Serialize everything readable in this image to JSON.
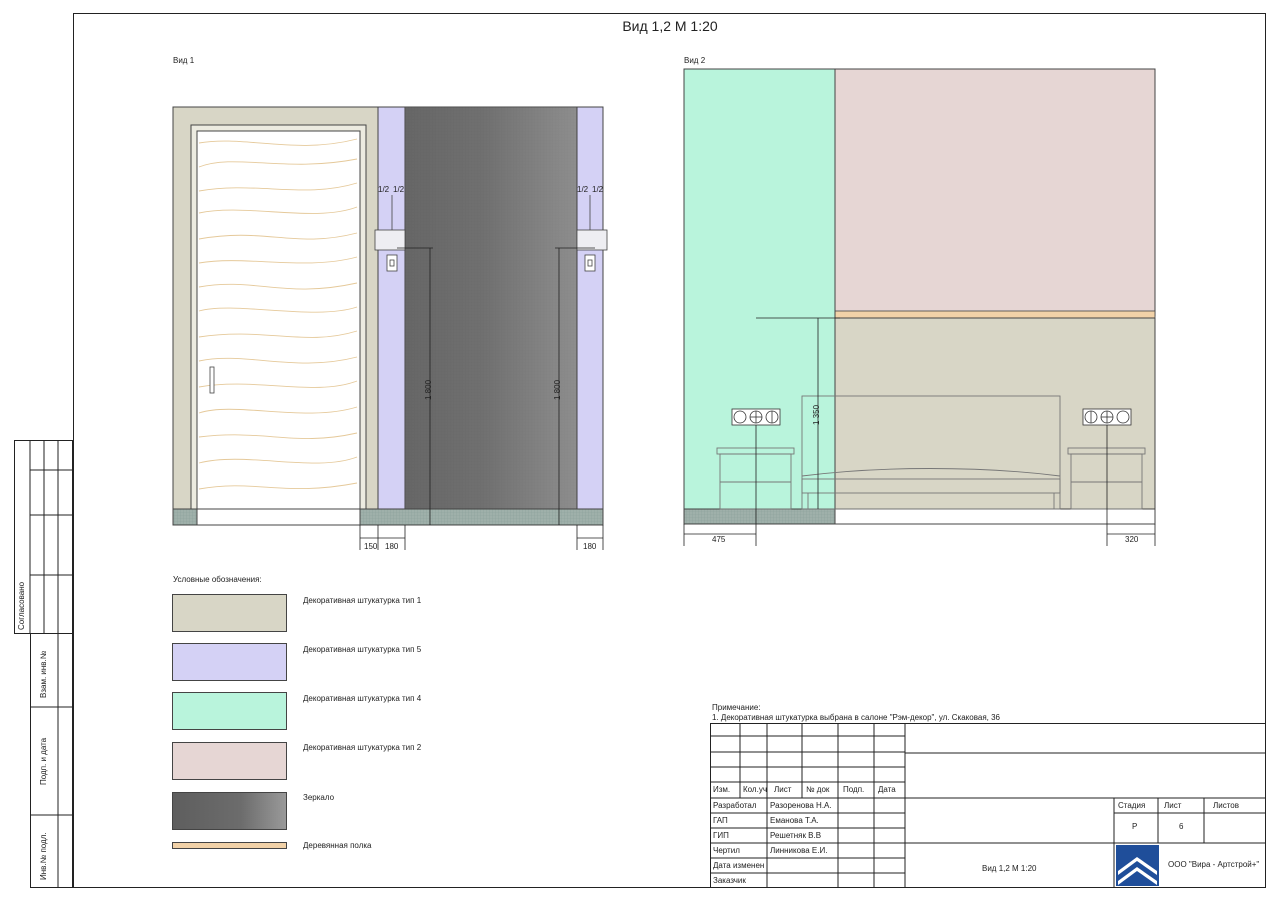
{
  "title": "Вид 1,2  М 1:20",
  "view1": {
    "label": "Вид 1",
    "dims": {
      "left_gap": "150",
      "left_panel": "180",
      "right_panel": "180",
      "height_left": "1 800",
      "height_right": "1 800"
    },
    "switch_labels": [
      "1/2",
      "1/2",
      "1/2",
      "1/2"
    ]
  },
  "view2": {
    "label": "Вид 2",
    "dims": {
      "left": "475",
      "right": "320",
      "height": "1 350"
    }
  },
  "legend": {
    "title": "Условные обозначения:",
    "items": [
      {
        "label": "Декоративная штукатурка тип 1",
        "color": "#d8d6c6"
      },
      {
        "label": "Декоративная штукатурка тип 5",
        "color": "#d4d1f5"
      },
      {
        "label": "Декоративная штукатурка тип 4",
        "color": "#b9f4dc"
      },
      {
        "label": "Декоративная штукатурка тип 2",
        "color": "#e6d6d4"
      },
      {
        "label": "Зеркало",
        "color": "#6e6e6e"
      },
      {
        "label": "Деревянная полка",
        "color": "#f2d2a8"
      }
    ]
  },
  "note": {
    "heading": "Примечание:",
    "text": "1. Декоративная штукатурка выбрана в салоне \"Рэм-декор\", ул. Скаковая, 36"
  },
  "left_margin": {
    "agreed": "Согласовано",
    "fields": [
      "Взам. инв.№",
      "Подп. и дата",
      "Инв.№ подл."
    ]
  },
  "title_block": {
    "header_cols": [
      "Изм.",
      "Кол.уч",
      "Лист",
      "№ док",
      "Подп.",
      "Дата"
    ],
    "roles": [
      {
        "role": "Разработал",
        "name": "Разоренова Н.А."
      },
      {
        "role": "ГАП",
        "name": "Еманова Т.А."
      },
      {
        "role": "ГИП",
        "name": "Решетняк В.В"
      },
      {
        "role": "Чертил",
        "name": "Линникова Е.И."
      },
      {
        "role": "Дата изменен",
        "name": ""
      },
      {
        "role": "Заказчик",
        "name": ""
      }
    ],
    "stage_label": "Стадия",
    "sheet_label": "Лист",
    "sheets_label": "Листов",
    "stage_value": "Р",
    "sheet_value": "6",
    "sheets_value": "",
    "drawing_name": "Вид 1,2  М 1:20",
    "company": "ООО \"Вира - Артстрой+\""
  }
}
